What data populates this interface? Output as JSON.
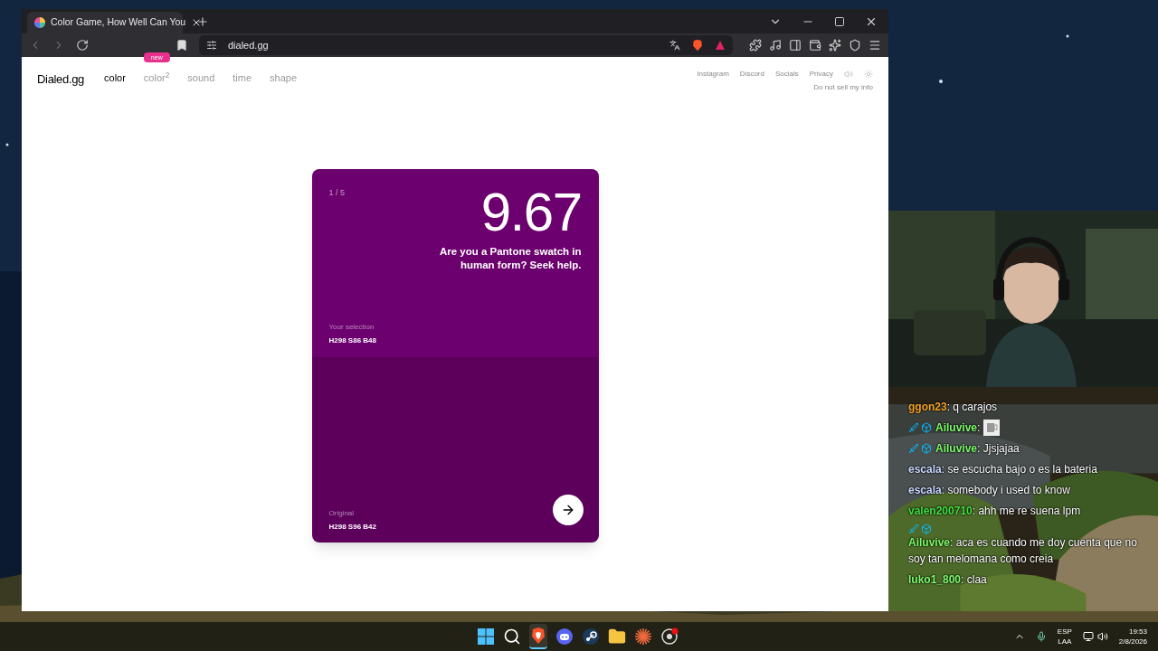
{
  "browser": {
    "tab": {
      "title": "Color Game, How Well Can You",
      "selected": true
    },
    "address": "dialed.gg"
  },
  "site": {
    "logo": "Dialed.gg",
    "nav": [
      {
        "label": "color",
        "selected": true
      },
      {
        "label": "color$^{2}$",
        "selected": false,
        "badge": "new"
      },
      {
        "label": "sound",
        "selected": false
      },
      {
        "label": "time",
        "selected": false
      },
      {
        "label": "shape",
        "selected": false
      }
    ],
    "links": [
      "Instagram",
      "Discord",
      "Socials",
      "Privacy"
    ],
    "privacy_note": "Do not sell my info"
  },
  "card": {
    "progress": "1 / 5",
    "score": "9.67",
    "message": "Are you a Pantone swatch in human form? Seek help.",
    "selection": {
      "label": "Your selection",
      "value": "H298 S86 B48",
      "color": "#6c006e"
    },
    "original": {
      "label": "Original",
      "value": "H298 S96 B42",
      "color": "#5c005c"
    }
  },
  "chat": [
    {
      "user": "ggon23",
      "separator": ":",
      "color": "#f0a020",
      "badges": false,
      "text": "q carajos"
    },
    {
      "user": "Ailuvive",
      "separator": ":",
      "color": "#7cfc6a",
      "badges": true,
      "kind": "emote"
    },
    {
      "user": "Ailuvive",
      "separator": ":",
      "color": "#7cfc6a",
      "badges": true,
      "text": "Jjsjajaa"
    },
    {
      "user": "escala",
      "separator": ":",
      "color": "#c8d8ff",
      "badges": false,
      "text": "se escucha bajo o es la bateria"
    },
    {
      "user": "escala",
      "separator": ":",
      "color": "#c8d8ff",
      "badges": false,
      "text": "somebody i used to know"
    },
    {
      "user": "valen200710",
      "separator": ":",
      "color": "#40e040",
      "badges": false,
      "text": "ahh me re suena lpm"
    },
    {
      "user": "Ailuvive",
      "separator": ":",
      "color": "#7cfc6a",
      "badges": true,
      "text": "aca es cuando me doy cuenta que no soy tan melomana como creia"
    },
    {
      "user": "luko1_800",
      "separator": ":",
      "color": "#7cfc6a",
      "badges": false,
      "text": "claa"
    }
  ],
  "taskbar": {
    "apps": [
      {
        "kind": "start",
        "active": false
      },
      {
        "kind": "search",
        "active": false
      },
      {
        "kind": "browser",
        "active": true
      },
      {
        "kind": "chat",
        "active": false
      },
      {
        "kind": "steam",
        "active": false
      },
      {
        "kind": "folder",
        "active": false
      },
      {
        "kind": "burst",
        "active": false
      },
      {
        "kind": "record",
        "active": false
      }
    ],
    "language": "ESP",
    "layout": "LAA",
    "time": "19:53",
    "date": "2/8/2026"
  }
}
